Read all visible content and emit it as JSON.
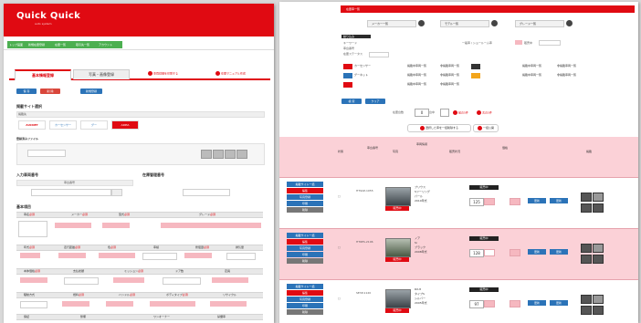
{
  "left": {
    "logo": "Quick Quick",
    "logo_sub": "auto system",
    "nav_items": [
      "トップ画面",
      "新規在庫登録",
      "在庫一覧",
      "取引先一覧",
      "アカウント"
    ],
    "tab_active": "基本情報登録",
    "tab_other": "写真・画像登録",
    "link1": "車両詳細を印刷する",
    "link2": "在庫マニュアル作成",
    "btn_blue1": "保 存",
    "btn_red1": "削 除",
    "btn_blue2": "新規登録",
    "section_ads": "掲載サイト選択",
    "ads_sub": "掲載先",
    "site_chips": [
      "AUCNET",
      "カーセンサー",
      "グー",
      "ARPIA"
    ],
    "section_photo": "登録済みファイル",
    "section_stock": "入力車両番号",
    "section_stock2": "在庫管理番号",
    "stock_label": "車台番号",
    "section_basic": "基本項目",
    "header_cols": [
      "車名",
      "メーカー",
      "型式",
      "グレード"
    ],
    "req": "必須",
    "row2_cols": [
      "年式",
      "走行距離",
      "色",
      "車検",
      "修復歴",
      "排気量"
    ],
    "row3_cols": [
      "本体価格",
      "支払総額",
      "ミッション",
      "ドア数",
      "定員"
    ],
    "row4_cols": [
      "駆動方式",
      "燃料",
      "ハンドル",
      "ボディタイプ",
      "リサイクル"
    ],
    "row5_cols": [
      "保証",
      "整備",
      "ワンオーナー",
      "禁煙車"
    ]
  },
  "right": {
    "band": "在庫車一覧",
    "search_selects": [
      "メーカー一覧",
      "モデル一覧",
      "グレード一覧"
    ],
    "filter_title": "絞り込み",
    "filter_labels": [
      "キーワード",
      "車台番号",
      "在庫ステータス"
    ],
    "filter_inline": "一般車 / ショールーム車",
    "filter_status": "販売中",
    "site_rows": [
      {
        "name": "カーセンサー",
        "a": "掲載中車両一覧",
        "b": "非掲載車両一覧",
        "c": "掲載中車両一覧",
        "d": "非掲載車両一覧"
      },
      {
        "name": "グーネット",
        "a": "掲載中車両一覧",
        "b": "非掲載車両一覧",
        "c": "掲載中車両一覧",
        "d": "非掲載車両一覧"
      },
      {
        "name": "ARPIA",
        "a": "掲載中車両一覧",
        "b": "非掲載車両一覧",
        "c": "",
        "": ""
      }
    ],
    "btn_search": "検 索",
    "btn_clear": "クリア",
    "pager_prev": "前の5件",
    "pager_next": "次の5件",
    "pager_num": "0",
    "pager_total": "台中",
    "all_btn": "選択した車を一括削除する",
    "all_btn2": "一括公開",
    "col_headers": [
      "状態",
      "車台番号",
      "写真",
      "車両情報",
      "販売状況",
      "価格",
      "掲載"
    ],
    "cards": [
      {
        "id": "HT92Z-1055",
        "model": "プリウス",
        "desc": "Sツーリング",
        "color": "パール",
        "price": "125",
        "stat": "販売中",
        "sub": "2010年式"
      },
      {
        "id": "HT6ES-2106",
        "model": "ノア",
        "desc": "Si",
        "color": "ブラック",
        "price": "128",
        "stat": "販売中",
        "sub": "2008年式"
      },
      {
        "id": "SE3P-1120",
        "model": "RX-8",
        "desc": "タイプS",
        "color": "シルバー",
        "price": "97",
        "stat": "販売中",
        "sub": "2005年式"
      }
    ],
    "side_btns": [
      "掲載サイト一括",
      "編集",
      "写真登録",
      "印刷",
      "削除"
    ],
    "update_btn": "更新"
  }
}
